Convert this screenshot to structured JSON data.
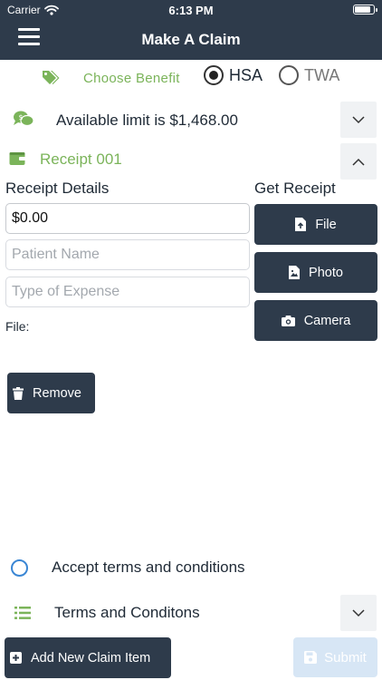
{
  "status_bar": {
    "carrier": "Carrier",
    "time": "6:13 PM",
    "battery_level": 0.9
  },
  "nav": {
    "title": "Make A Claim",
    "menu_icon": "hamburger-menu-icon"
  },
  "benefit": {
    "label": "Choose Benefit",
    "icon": "tags-icon",
    "options": [
      {
        "label": "HSA",
        "selected": true
      },
      {
        "label": "TWA",
        "selected": false
      }
    ]
  },
  "limit": {
    "text": "Available limit is $1,468.00",
    "icon": "money-chat-icon",
    "expanded": false
  },
  "receipt": {
    "title": "Receipt 001",
    "icon": "wallet-icon",
    "expanded": true,
    "details_heading": "Receipt Details",
    "amount_value": "$0.00",
    "patient_placeholder": "Patient Name",
    "expense_placeholder": "Type of Expense",
    "file_label": "File:",
    "remove_label": "Remove"
  },
  "get_receipt": {
    "heading": "Get Receipt",
    "file_label": "File",
    "photo_label": "Photo",
    "camera_label": "Camera"
  },
  "terms": {
    "accept_label": "Accept terms and conditions",
    "accepted": false,
    "section_title": "Terms and Conditons"
  },
  "footer": {
    "add_label": "Add New Claim Item",
    "submit_label": "Submit"
  },
  "colors": {
    "navy": "#2e3b4b",
    "green": "#7bb45a",
    "radio_accent": "#3a86d4",
    "submit_disabled": "#d7e6f5"
  }
}
